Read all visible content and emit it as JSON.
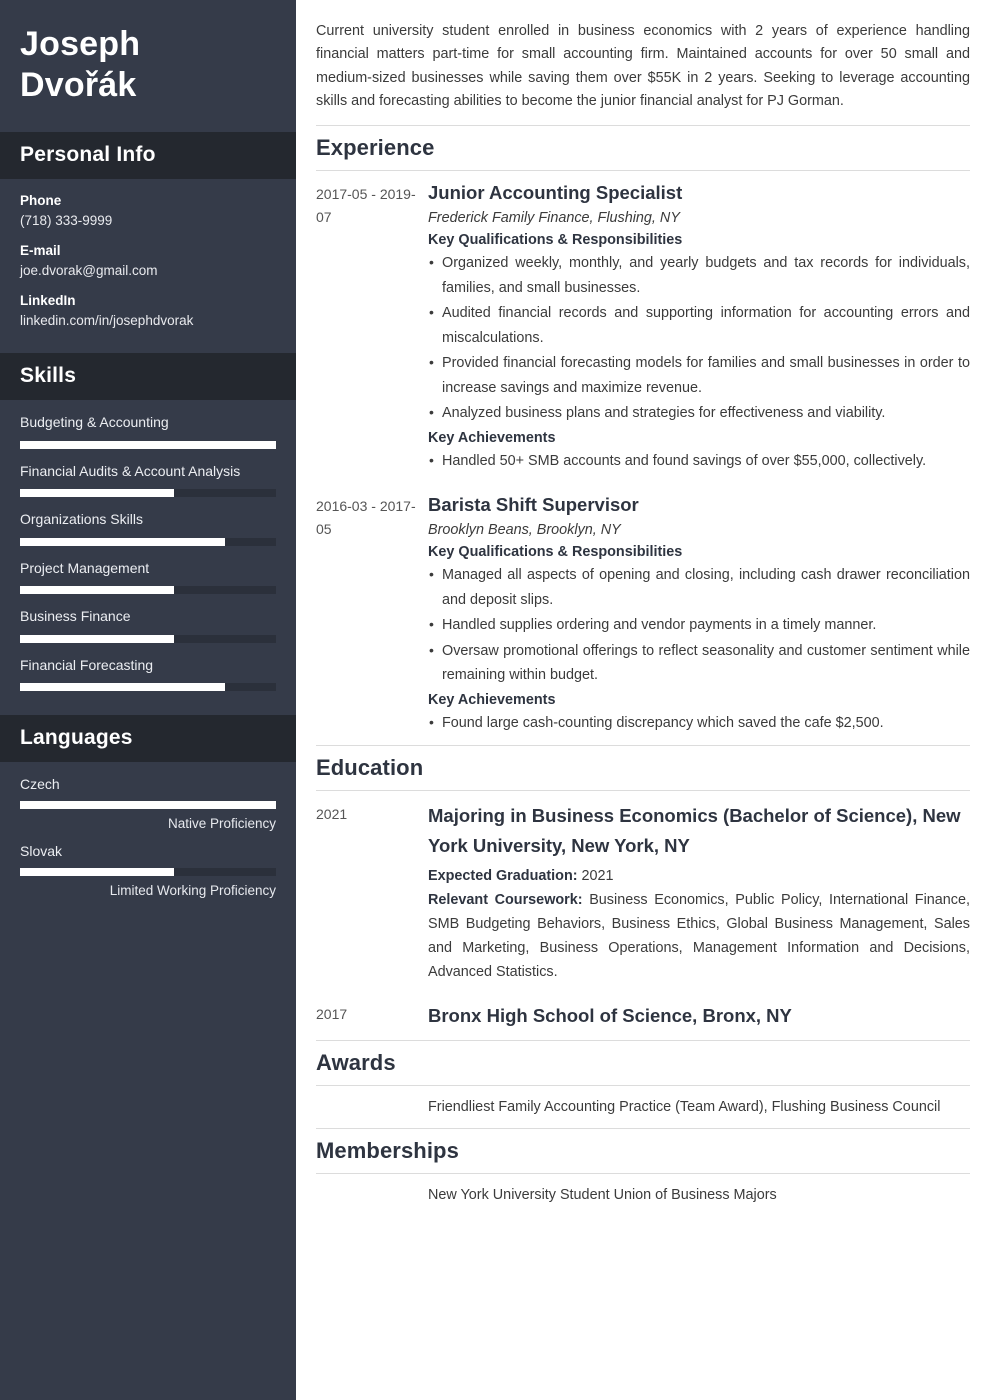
{
  "sidebar": {
    "name_lines": [
      "Joseph",
      "Dvořák"
    ],
    "personal_info": {
      "heading": "Personal Info",
      "items": [
        {
          "label": "Phone",
          "value": "(718) 333-9999"
        },
        {
          "label": "E-mail",
          "value": "joe.dvorak@gmail.com"
        },
        {
          "label": "LinkedIn",
          "value": "linkedin.com/in/josephdvorak"
        }
      ]
    },
    "skills": {
      "heading": "Skills",
      "items": [
        {
          "name": "Budgeting & Accounting",
          "level": 100
        },
        {
          "name": "Financial Audits & Account Analysis",
          "level": 60
        },
        {
          "name": "Organizations Skills",
          "level": 80
        },
        {
          "name": "Project Management",
          "level": 60
        },
        {
          "name": "Business Finance",
          "level": 60
        },
        {
          "name": "Financial Forecasting",
          "level": 80
        }
      ]
    },
    "languages": {
      "heading": "Languages",
      "items": [
        {
          "name": "Czech",
          "level": 100,
          "proficiency": "Native Proficiency"
        },
        {
          "name": "Slovak",
          "level": 60,
          "proficiency": "Limited Working Proficiency"
        }
      ]
    }
  },
  "main": {
    "summary": "Current university student enrolled in business economics with 2 years of experience handling financial matters part-time for small accounting firm. Maintained accounts for over 50 small and medium-sized businesses while saving them over $55K in 2 years. Seeking to leverage accounting skills and forecasting abilities to become the junior financial analyst for PJ Gorman.",
    "experience": {
      "heading": "Experience",
      "entries": [
        {
          "date": "2017-05 - 2019-07",
          "title": "Junior Accounting Specialist",
          "org": "Frederick Family Finance, Flushing, NY",
          "qualifications_heading": "Key Qualifications & Responsibilities",
          "qualifications": [
            "Organized weekly, monthly, and yearly budgets and tax records for individuals, families, and small businesses.",
            "Audited financial records and supporting information for accounting errors and miscalculations.",
            "Provided financial forecasting models for families and small businesses in order to increase savings and maximize revenue.",
            "Analyzed business plans and strategies for effectiveness and viability."
          ],
          "achievements_heading": "Key Achievements",
          "achievements": [
            "Handled 50+ SMB accounts and found savings of over $55,000, collectively."
          ]
        },
        {
          "date": "2016-03 - 2017-05",
          "title": "Barista Shift Supervisor",
          "org": "Brooklyn Beans, Brooklyn, NY",
          "qualifications_heading": "Key Qualifications & Responsibilities",
          "qualifications": [
            "Managed all aspects of opening and closing, including cash drawer reconciliation and deposit slips.",
            "Handled supplies ordering and vendor payments in a timely manner.",
            "Oversaw promotional offerings to reflect seasonality and customer sentiment while remaining within budget."
          ],
          "achievements_heading": "Key Achievements",
          "achievements": [
            "Found large cash-counting discrepancy which saved the cafe $2,500."
          ]
        }
      ]
    },
    "education": {
      "heading": "Education",
      "entries": [
        {
          "date": "2021",
          "title": "Majoring in Business Economics (Bachelor of Science),  New York University, New York, NY",
          "graduation_label": "Expected Graduation:",
          "graduation_value": "2021",
          "coursework_label": "Relevant Coursework:",
          "coursework_value": "Business Economics, Public Policy, International Finance, SMB Budgeting Behaviors, Business Ethics, Global Business Management, Sales and Marketing, Business Operations, Management Information and Decisions, Advanced Statistics."
        },
        {
          "date": "2017",
          "title": "Bronx High School of Science, Bronx, NY",
          "graduation_label": "",
          "graduation_value": "",
          "coursework_label": "",
          "coursework_value": ""
        }
      ]
    },
    "awards": {
      "heading": "Awards",
      "items": [
        "Friendliest Family Accounting Practice (Team Award), Flushing Business Council"
      ]
    },
    "memberships": {
      "heading": "Memberships",
      "items": [
        "New York University Student Union of Business Majors"
      ]
    }
  },
  "colors": {
    "sidebar_bg": "#353b49",
    "sidebar_head_bg": "#24282f",
    "bar_track": "#2b303b",
    "bar_fill": "#ffffff",
    "heading_text": "#2e3440",
    "body_text": "#3b3b3b"
  }
}
